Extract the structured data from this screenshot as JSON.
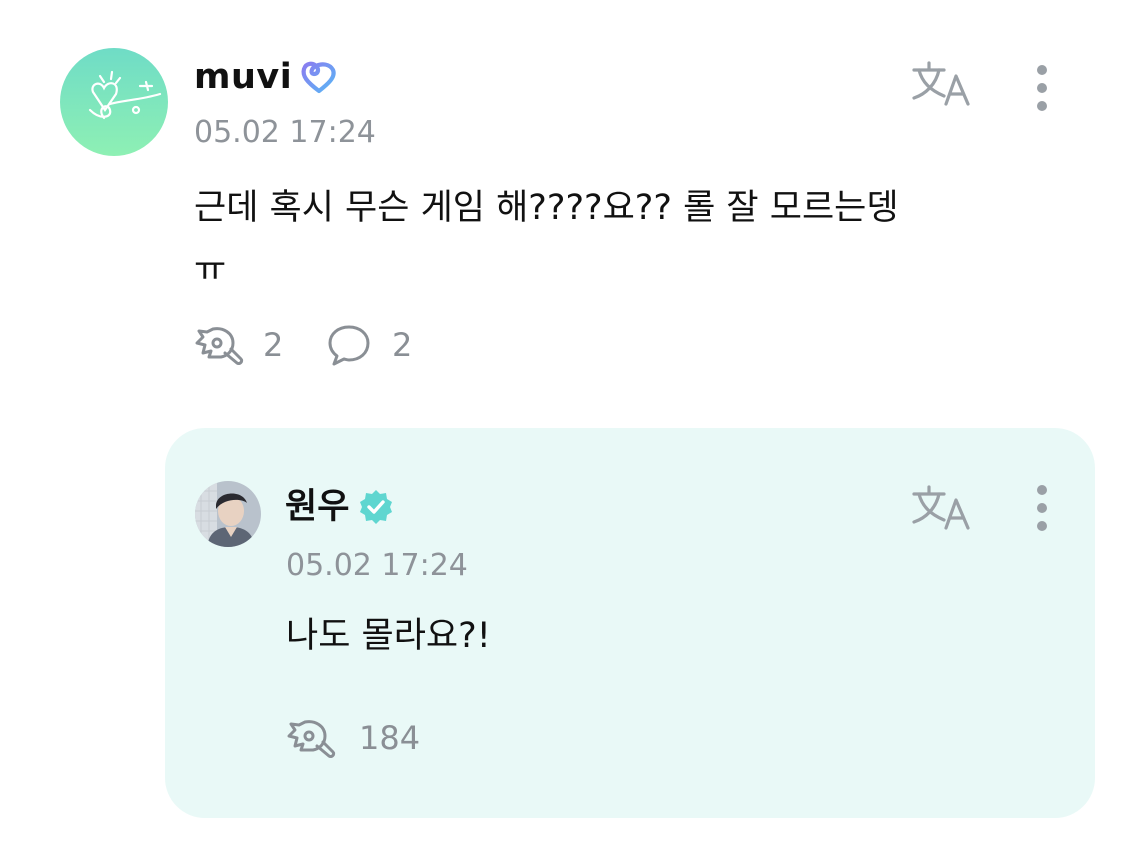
{
  "comment": {
    "author": "muvi",
    "timestamp": "05.02 17:24",
    "text_line1": "근데 혹시 무슨 게임 해????요?? 롤 잘 모르는뎅",
    "text_line2": "ㅠ",
    "like_count": "2",
    "reply_count": "2",
    "icons": {
      "badge": "heart-loop-badge-icon",
      "translate": "translate-icon",
      "more": "more-vertical-icon",
      "like": "like-icon",
      "reply": "comment-bubble-icon"
    }
  },
  "reply": {
    "author": "원우",
    "timestamp": "05.02 17:24",
    "text": "나도 몰라요?!",
    "like_count": "184",
    "icons": {
      "badge": "verified-badge-icon",
      "translate": "translate-icon",
      "more": "more-vertical-icon",
      "like": "like-icon"
    }
  },
  "colors": {
    "reply_background": "#e9f9f7",
    "verified_badge": "#5fd6d0",
    "muted_text": "#8e9399",
    "avatar_gradient_top": "#6fdcc6",
    "avatar_gradient_bottom": "#8ef0b4"
  }
}
